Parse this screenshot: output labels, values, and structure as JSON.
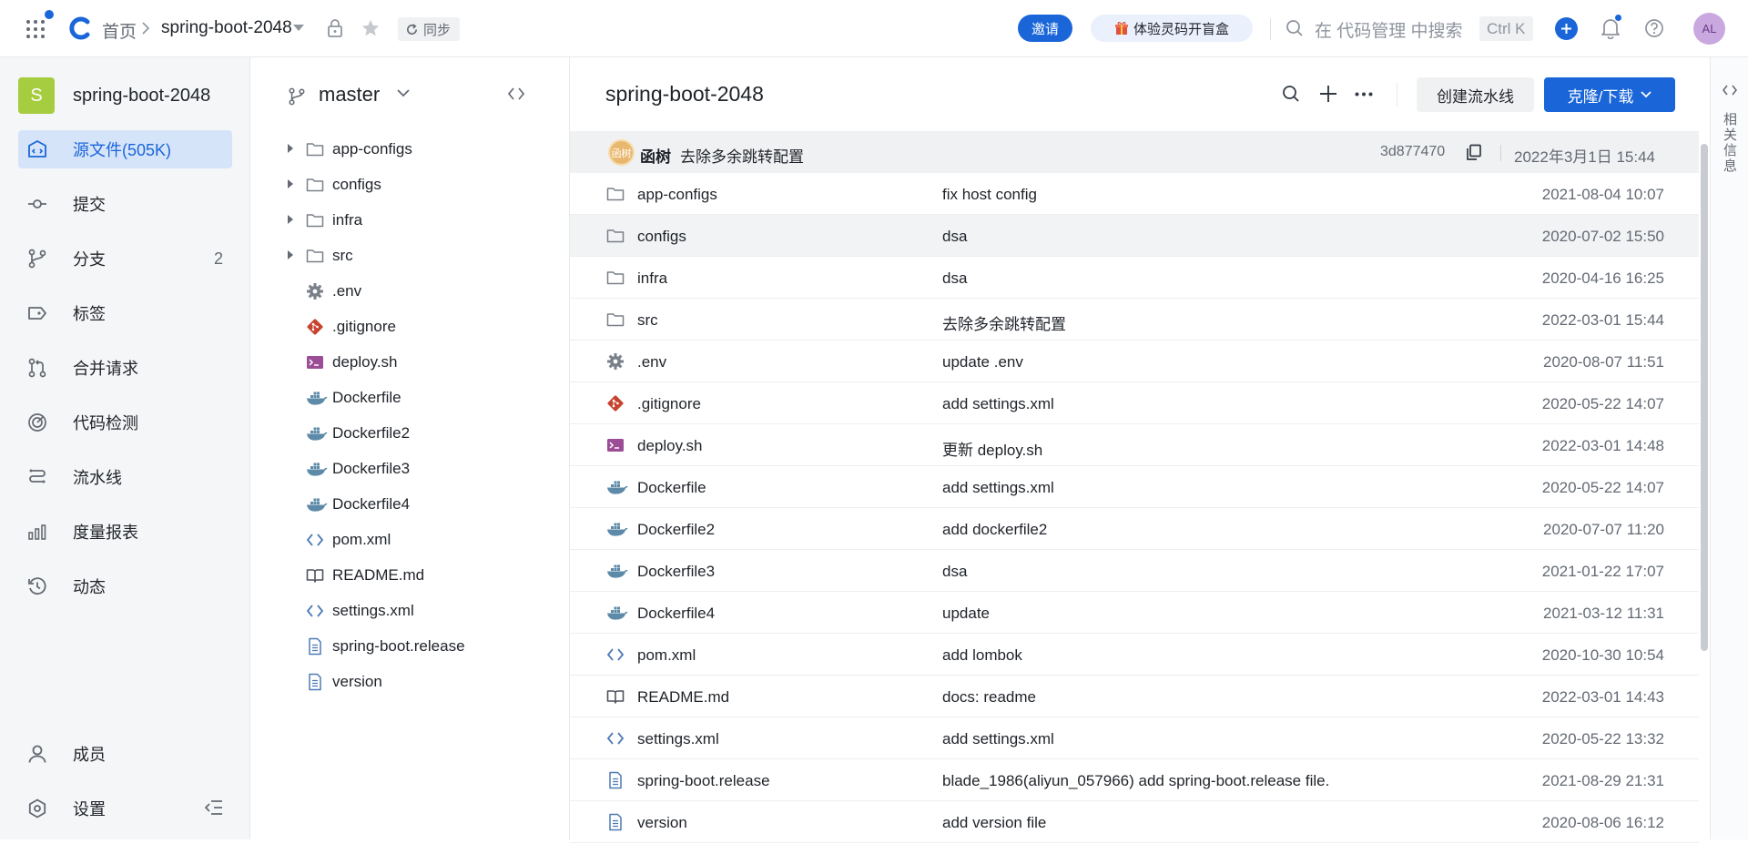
{
  "topbar": {
    "home": "首页",
    "repo": "spring-boot-2048",
    "sync": "同步",
    "invite": "邀请",
    "promo": "体验灵码开盲盒",
    "search_placeholder": "在 代码管理 中搜索",
    "shortcut": "Ctrl K",
    "avatar": "AL",
    "accent_color": "#1a66d9"
  },
  "sidebar": {
    "project_initial": "S",
    "project_name": "spring-boot-2048",
    "items": [
      {
        "label": "源文件(505K)",
        "icon": "source-files-icon"
      },
      {
        "label": "提交",
        "icon": "commit-icon"
      },
      {
        "label": "分支",
        "icon": "branch-icon",
        "count": "2"
      },
      {
        "label": "标签",
        "icon": "tag-icon"
      },
      {
        "label": "合并请求",
        "icon": "merge-request-icon"
      },
      {
        "label": "代码检测",
        "icon": "code-scan-icon"
      },
      {
        "label": "流水线",
        "icon": "pipeline-icon"
      },
      {
        "label": "度量报表",
        "icon": "metrics-icon"
      },
      {
        "label": "动态",
        "icon": "activity-icon"
      }
    ],
    "bottom": [
      {
        "label": "成员",
        "icon": "member-icon"
      },
      {
        "label": "设置",
        "icon": "settings-icon"
      }
    ]
  },
  "tree": {
    "branch": "master",
    "items": [
      {
        "name": "app-configs",
        "type": "folder"
      },
      {
        "name": "configs",
        "type": "folder"
      },
      {
        "name": "infra",
        "type": "folder"
      },
      {
        "name": "src",
        "type": "folder"
      },
      {
        "name": ".env",
        "type": "gear"
      },
      {
        "name": ".gitignore",
        "type": "git"
      },
      {
        "name": "deploy.sh",
        "type": "shell"
      },
      {
        "name": "Dockerfile",
        "type": "docker"
      },
      {
        "name": "Dockerfile2",
        "type": "docker"
      },
      {
        "name": "Dockerfile3",
        "type": "docker"
      },
      {
        "name": "Dockerfile4",
        "type": "docker"
      },
      {
        "name": "pom.xml",
        "type": "code"
      },
      {
        "name": "README.md",
        "type": "book"
      },
      {
        "name": "settings.xml",
        "type": "code"
      },
      {
        "name": "spring-boot.release",
        "type": "doc"
      },
      {
        "name": "version",
        "type": "doc"
      }
    ]
  },
  "main": {
    "title": "spring-boot-2048",
    "create_pipeline": "创建流水线",
    "clone": "克隆/下载",
    "commit": {
      "avatar": "函树",
      "author": "函树",
      "message": "去除多余跳转配置",
      "hash": "3d877470",
      "date": "2022年3月1日 15:44"
    },
    "files": [
      {
        "name": "app-configs",
        "type": "folder",
        "message": "fix host config",
        "date": "2021-08-04 10:07"
      },
      {
        "name": "configs",
        "type": "folder",
        "message": "dsa",
        "date": "2020-07-02 15:50"
      },
      {
        "name": "infra",
        "type": "folder",
        "message": "dsa",
        "date": "2020-04-16 16:25"
      },
      {
        "name": "src",
        "type": "folder",
        "message": "去除多余跳转配置",
        "date": "2022-03-01 15:44"
      },
      {
        "name": ".env",
        "type": "gear",
        "message": "update .env",
        "date": "2020-08-07 11:51"
      },
      {
        "name": ".gitignore",
        "type": "git",
        "message": "add settings.xml",
        "date": "2020-05-22 14:07"
      },
      {
        "name": "deploy.sh",
        "type": "shell",
        "message": "更新 deploy.sh",
        "date": "2022-03-01 14:48"
      },
      {
        "name": "Dockerfile",
        "type": "docker",
        "message": "add settings.xml",
        "date": "2020-05-22 14:07"
      },
      {
        "name": "Dockerfile2",
        "type": "docker",
        "message": "add dockerfile2",
        "date": "2020-07-07 11:20"
      },
      {
        "name": "Dockerfile3",
        "type": "docker",
        "message": "dsa",
        "date": "2021-01-22 17:07"
      },
      {
        "name": "Dockerfile4",
        "type": "docker",
        "message": "update",
        "date": "2021-03-12 11:31"
      },
      {
        "name": "pom.xml",
        "type": "code",
        "message": "add lombok",
        "date": "2020-10-30 10:54"
      },
      {
        "name": "README.md",
        "type": "book",
        "message": "docs: readme",
        "date": "2022-03-01 14:43"
      },
      {
        "name": "settings.xml",
        "type": "code",
        "message": "add settings.xml",
        "date": "2020-05-22 13:32"
      },
      {
        "name": "spring-boot.release",
        "type": "doc",
        "message": "blade_1986(aliyun_057966) add spring-boot.release file.",
        "date": "2021-08-29 21:31"
      },
      {
        "name": "version",
        "type": "doc",
        "message": "add version file",
        "date": "2020-08-06 16:12"
      }
    ]
  },
  "rail": {
    "label": "相关信息"
  }
}
